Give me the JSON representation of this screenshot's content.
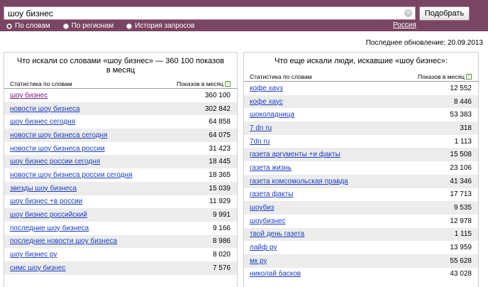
{
  "search": {
    "query": "шоу бизнес",
    "submit_label": "Подобрать"
  },
  "modes": [
    {
      "label": "По словам",
      "selected": true
    },
    {
      "label": "По регионам",
      "selected": false
    },
    {
      "label": "История запросов",
      "selected": false
    }
  ],
  "region_label": "Россия",
  "last_updated": "Последнее обновление: 20.09.2013",
  "left_panel": {
    "title": "Что искали со словами «шоу бизнес» — 360 100 показов в месяц",
    "col_stats": "Статистика по словам",
    "col_shows": "Показов в месяц",
    "rows": [
      {
        "phrase": "шоу бизнес",
        "count": "360 100"
      },
      {
        "phrase": "новости шоу бизнеса",
        "count": "302 842"
      },
      {
        "phrase": "шоу бизнес сегодня",
        "count": "64 858"
      },
      {
        "phrase": "новости шоу бизнеса сегодня",
        "count": "64 075"
      },
      {
        "phrase": "новости шоу бизнеса россии",
        "count": "31 423"
      },
      {
        "phrase": "шоу бизнес россии сегодня",
        "count": "18 445"
      },
      {
        "phrase": "новости шоу бизнеса россии сегодня",
        "count": "18 365"
      },
      {
        "phrase": "звезды шоу бизнеса",
        "count": "15 039"
      },
      {
        "phrase": "шоу бизнес +в россии",
        "count": "11 929"
      },
      {
        "phrase": "шоу бизнес российский",
        "count": "9 991"
      },
      {
        "phrase": "последние шоу бизнеса",
        "count": "9 166"
      },
      {
        "phrase": "последние новости шоу бизнеса",
        "count": "8 986"
      },
      {
        "phrase": "шоу бизнес ру",
        "count": "8 020"
      },
      {
        "phrase": "симс шоу бизнес",
        "count": "7 576"
      }
    ]
  },
  "right_panel": {
    "title": "Что еще искали люди, искавшие «шоу бизнес»:",
    "col_stats": "Статистика по словам",
    "col_shows": "Показов в месяц",
    "rows": [
      {
        "phrase": "кофе хауз",
        "count": "12 552"
      },
      {
        "phrase": "кофе хаус",
        "count": "8 446"
      },
      {
        "phrase": "шоколадница",
        "count": "53 383"
      },
      {
        "phrase": "7 dn ru",
        "count": "318"
      },
      {
        "phrase": "7dn ru",
        "count": "1 113"
      },
      {
        "phrase": "газета аргументы +и факты",
        "count": "15 508"
      },
      {
        "phrase": "газета жизнь",
        "count": "23 106"
      },
      {
        "phrase": "газета комсомольская правда",
        "count": "41 346"
      },
      {
        "phrase": "газета факты",
        "count": "17 713"
      },
      {
        "phrase": "шоубиз",
        "count": "9 535"
      },
      {
        "phrase": "шоубизнес",
        "count": "12 978"
      },
      {
        "phrase": "твой день газета",
        "count": "1 115"
      },
      {
        "phrase": "лайф ру",
        "count": "13 959"
      },
      {
        "phrase": "мк ру",
        "count": "55 628"
      },
      {
        "phrase": "николай басков",
        "count": "43 028"
      }
    ]
  }
}
